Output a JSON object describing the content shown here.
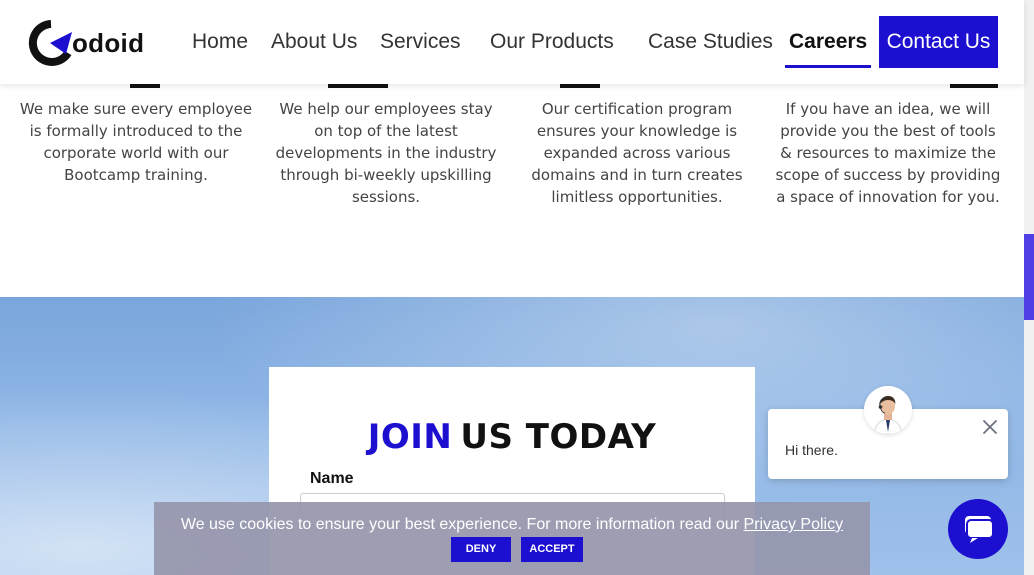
{
  "brand": {
    "logo_text": "odoid",
    "accent_color": "#1c0fd0"
  },
  "nav": {
    "items": [
      {
        "label": "Home"
      },
      {
        "label": "About Us"
      },
      {
        "label": "Services"
      },
      {
        "label": "Our Products"
      },
      {
        "label": "Case Studies"
      },
      {
        "label": "Careers",
        "active": true
      }
    ],
    "contact_label": "Contact Us"
  },
  "features": [
    {
      "text": [
        "We make sure every employee",
        "is formally introduced to the",
        "corporate world with our",
        "Bootcamp training."
      ]
    },
    {
      "text": [
        "We help our employees stay",
        "on top of the latest",
        "developments in the industry",
        "through bi-weekly upskilling",
        "sessions."
      ]
    },
    {
      "text": [
        "Our certification program",
        "ensures your knowledge is",
        "expanded across various",
        "domains and in turn creates",
        "limitless opportunities."
      ]
    },
    {
      "text": [
        "If you have an idea, we will",
        "provide you the best of tools",
        "& resources to maximize the",
        "scope of success by providing",
        "a space of innovation for you."
      ]
    }
  ],
  "join": {
    "title_accent": "JOIN",
    "title_rest": "US TODAY",
    "name_label": "Name",
    "name_value": ""
  },
  "cookie": {
    "text": "We use cookies to ensure your best experience. For more information read our",
    "policy_link": "Privacy Policy",
    "deny_label": "DENY",
    "accept_label": "ACCEPT"
  },
  "chat": {
    "greeting": "Hi there.",
    "close_icon": "close-icon",
    "launcher_icon": "chat-bubbles-icon"
  }
}
